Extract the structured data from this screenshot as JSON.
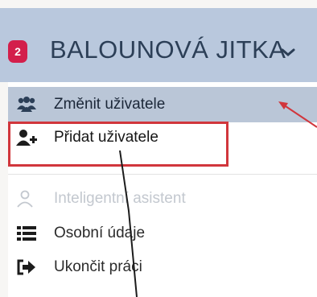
{
  "header": {
    "badge_count": "2",
    "user_name": "BALOUNOVÁ JITKA",
    "chevron": "⌄"
  },
  "menu": {
    "items": [
      {
        "label": "Změnit uživatele",
        "icon": "users-icon",
        "state": "active"
      },
      {
        "label": "Přidat uživatele",
        "icon": "user-plus-icon",
        "state": "highlighted"
      },
      {
        "label": "Inteligentní asistent",
        "icon": "user-outline-icon",
        "state": "disabled"
      },
      {
        "label": "Osobní údaje",
        "icon": "list-icon",
        "state": "normal"
      },
      {
        "label": "Ukončit práci",
        "icon": "sign-out-icon",
        "state": "normal"
      }
    ]
  },
  "colors": {
    "header_bg": "#b9c8dd",
    "badge": "#d31f4b",
    "annotation": "#d1363c",
    "active_item_bg": "#bac6d7"
  }
}
